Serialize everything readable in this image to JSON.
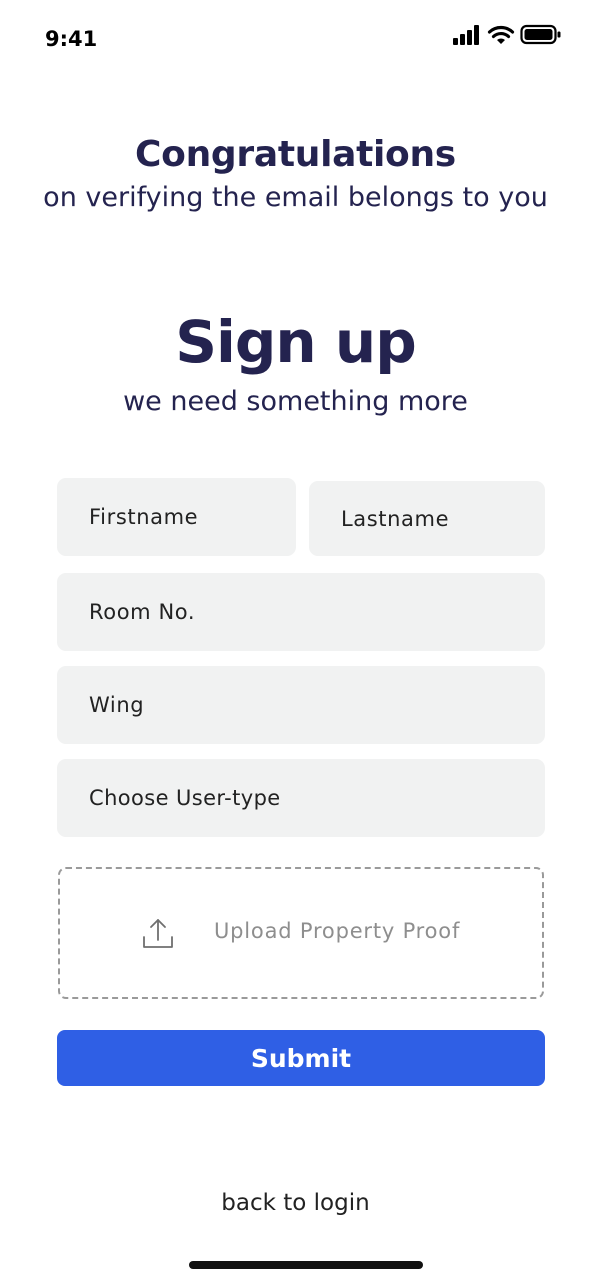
{
  "status_bar": {
    "time": "9:41",
    "icons": [
      "signal-icon",
      "wifi-icon",
      "battery-icon"
    ]
  },
  "header": {
    "title": "Congratulations",
    "subtitle": "on verifying the email belongs to you"
  },
  "signup": {
    "title": "Sign up",
    "subtitle": "we need something more"
  },
  "form": {
    "firstname_placeholder": "Firstname",
    "lastname_placeholder": "Lastname",
    "room_placeholder": "Room No.",
    "wing_placeholder": "Wing",
    "usertype_label": "Choose User-type",
    "upload_label": "Upload Property Proof",
    "upload_icon": "upload-icon",
    "submit_label": "Submit"
  },
  "footer": {
    "back_link": "back to login"
  },
  "colors": {
    "heading": "#24234f",
    "field_bg": "#f1f2f2",
    "primary": "#2f5fe5"
  }
}
